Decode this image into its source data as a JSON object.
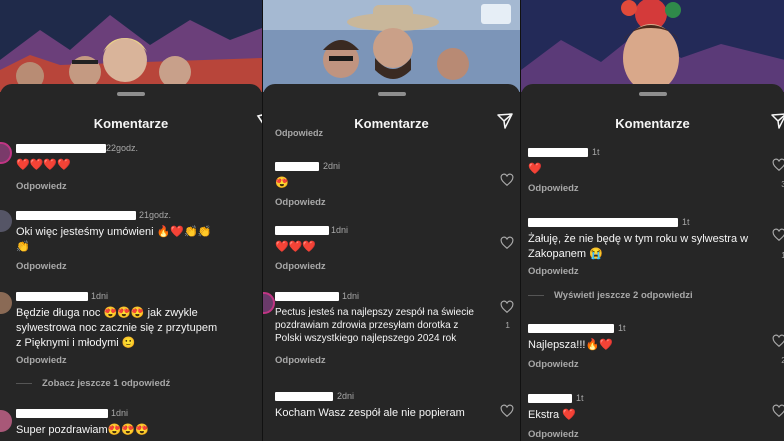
{
  "panels": [
    {
      "title": "Komentarze",
      "comments": [
        {
          "time": "22godz.",
          "text": "❤️❤️❤️❤️",
          "reply": "Odpowiedz"
        },
        {
          "time": "21godz.",
          "text": "Oki więc jesteśmy umówieni 🔥❤️👏👏👏",
          "reply": "Odpowiedz"
        },
        {
          "time": "1dni",
          "text": "Będzie długa noc 😍😍😍 jak zwykle sylwestrowa noc zacznie się z przytupem z Pięknymi i młodymi 🙂",
          "reply": "Odpowiedz"
        },
        {
          "time": "1dni",
          "text": "Super pozdrawiam😍😍😍",
          "reply": ""
        }
      ],
      "more_replies": "Zobacz jeszcze 1 odpowiedź"
    },
    {
      "title": "Komentarze",
      "comments": [
        {
          "time": "2dni",
          "text": "😍",
          "reply": "Odpowiedz"
        },
        {
          "time": "1dni",
          "text": "❤️❤️❤️",
          "reply": "Odpowiedz"
        },
        {
          "time": "1dni",
          "text": "Pectus jesteś na najlepszy zespół na świecie pozdrawiam zdrowia przesyłam dorotka z Polski wszystkiego najlepszego 2024 rok",
          "reply": "Odpowiedz",
          "likes": "1"
        },
        {
          "time": "2dni",
          "text": "Kocham Wasz zespół ale nie popieram",
          "reply": ""
        }
      ],
      "partial_header": "Odpowiedz"
    },
    {
      "title": "Komentarze",
      "comments": [
        {
          "time": "1t",
          "text": "❤️",
          "reply": "Odpowiedz",
          "likes": "3"
        },
        {
          "time": "1t",
          "text": "Żałuję, że nie będę w tym roku w sylwestra w Zakopanem 😭",
          "reply": "Odpowiedz",
          "likes": "1"
        },
        {
          "time": "1t",
          "text": "Najlepsza!!!🔥❤️",
          "reply": "Odpowiedz",
          "likes": "2"
        },
        {
          "time": "1t",
          "text": "Ekstra ❤️",
          "reply": "Odpowiedz"
        }
      ],
      "more_replies": "Wyświetl jeszcze 2 odpowiedzi"
    }
  ],
  "colors": {
    "sheet": "#262626",
    "text": "#f5f5f5",
    "muted": "#a8a8a8",
    "heart": "#ed4956"
  }
}
